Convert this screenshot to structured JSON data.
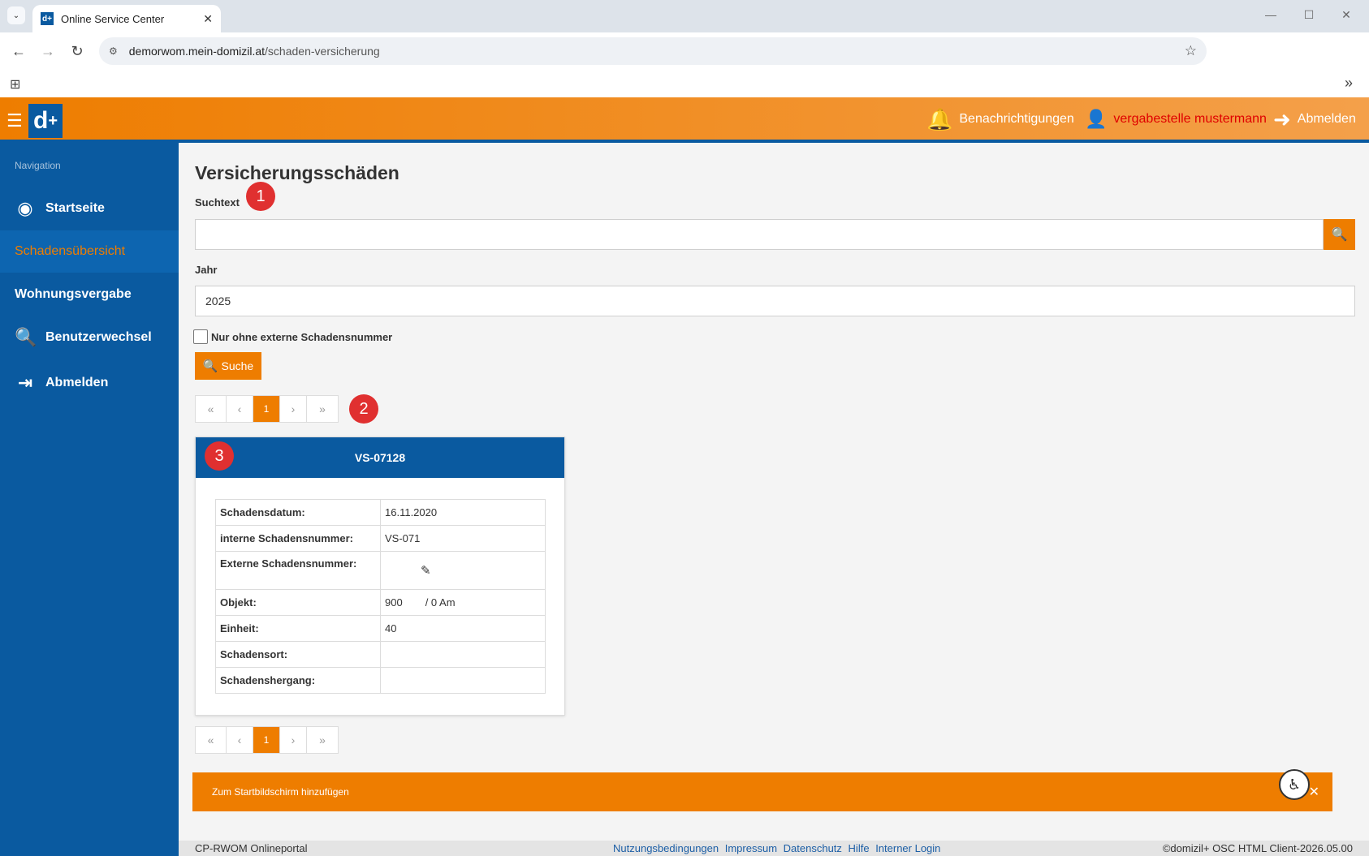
{
  "browser": {
    "tab_title": "Online Service Center",
    "favicon_text": "d+",
    "url_host": "demorwom.mein-domizil.at",
    "url_path": "/schaden-versicherung"
  },
  "header": {
    "logo": "d",
    "logo_sup": "+",
    "notifications": "Benachrichtigungen",
    "user": "vergabestelle mustermann",
    "logout": "Abmelden"
  },
  "sidebar": {
    "heading": "Navigation",
    "items": [
      {
        "label": "Startseite",
        "icon": "radio-dot-icon"
      },
      {
        "label": "Schadensübersicht",
        "icon": ""
      },
      {
        "label": "Wohnungsvergabe",
        "icon": ""
      },
      {
        "label": "Benutzerwechsel",
        "icon": "user-search-icon"
      },
      {
        "label": "Abmelden",
        "icon": "logout-icon"
      }
    ]
  },
  "main": {
    "title": "Versicherungsschäden",
    "search_label": "Suchtext",
    "search_value": "",
    "year_label": "Jahr",
    "year_value": "2025",
    "checkbox_label": "Nur ohne externe Schadensnummer",
    "search_button": "Suche",
    "badges": [
      "1",
      "2",
      "3"
    ],
    "pager": {
      "first": "«",
      "prev": "‹",
      "current": "1",
      "next": "›",
      "last": "»"
    }
  },
  "card": {
    "title": "VS-07128",
    "rows": [
      {
        "label": "Schadensdatum:",
        "value": "16.11.2020"
      },
      {
        "label": "interne Schadensnummer:",
        "value": "VS-071"
      },
      {
        "label": "Externe Schadensnummer:",
        "value": ""
      },
      {
        "label": "Objekt:",
        "value": "900",
        "value2": "/ 0 Am"
      },
      {
        "label": "Einheit:",
        "value": "40"
      },
      {
        "label": "Schadensort:",
        "value": ""
      },
      {
        "label": "Schadenshergang:",
        "value": ""
      }
    ]
  },
  "banner": {
    "text": "Zum Startbildschirm hinzufügen",
    "close": "✕"
  },
  "footer": {
    "left": "CP-RWOM Onlineportal",
    "links": [
      "Nutzungsbedingungen",
      "Impressum",
      "Datenschutz",
      "Hilfe",
      "Interner Login"
    ],
    "right": "©domizil+ OSC HTML Client-2026.05.00"
  },
  "colors": {
    "orange": "#ee7d00",
    "blue": "#0a5aa0",
    "badge_red": "#e03030",
    "user_red": "#e00000"
  }
}
